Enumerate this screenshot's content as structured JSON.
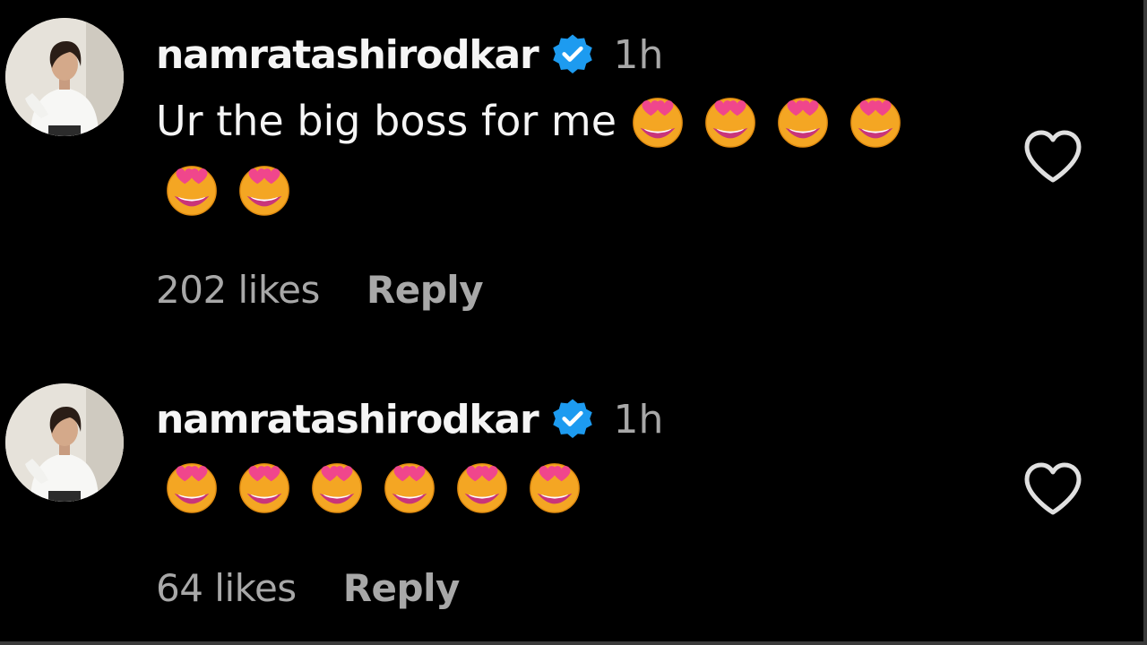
{
  "comments": [
    {
      "username": "namratashirodkar",
      "verified": true,
      "time": "1h",
      "text": "Ur the big boss for me",
      "emoji": "smiling-face-with-heart-eyes",
      "emoji_count_line1": 4,
      "emoji_count_line2": 2,
      "likes": "202 likes",
      "reply": "Reply"
    },
    {
      "username": "namratashirodkar",
      "verified": true,
      "time": "1h",
      "text": "",
      "emoji": "smiling-face-with-heart-eyes",
      "emoji_count_line1": 6,
      "likes": "64 likes",
      "reply": "Reply"
    }
  ],
  "colors": {
    "background": "#000000",
    "primary_text": "#f5f5f5",
    "secondary_text": "#a8a8a8",
    "verified_blue": "#1d9bf0",
    "emoji_face": "#f4a623",
    "emoji_heart": "#f0468c"
  },
  "icons": {
    "verified": "verified-badge-icon",
    "like": "heart-outline-icon"
  }
}
